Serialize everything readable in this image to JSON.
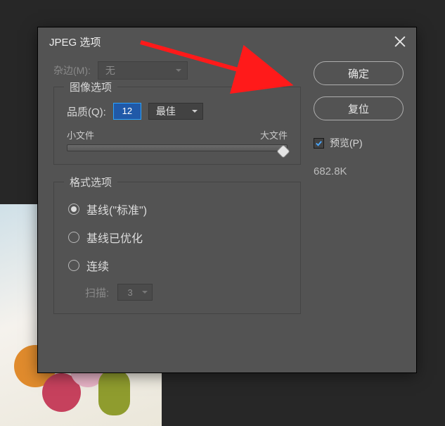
{
  "dialog": {
    "title": "JPEG 选项",
    "matte": {
      "label": "杂边(M):",
      "value": "无"
    },
    "imageOptions": {
      "legend": "图像选项",
      "qualityLabel": "品质(Q):",
      "qualityValue": "12",
      "qualityPreset": "最佳",
      "sliderMinLabel": "小文件",
      "sliderMaxLabel": "大文件"
    },
    "formatOptions": {
      "legend": "格式选项",
      "options": [
        "基线(\"标准\")",
        "基线已优化",
        "连续"
      ],
      "selectedIndex": 0,
      "scansLabel": "扫描:",
      "scansValue": "3"
    },
    "buttons": {
      "ok": "确定",
      "reset": "复位"
    },
    "preview": {
      "label": "预览(P)",
      "checked": true
    },
    "fileSize": "682.8K"
  }
}
